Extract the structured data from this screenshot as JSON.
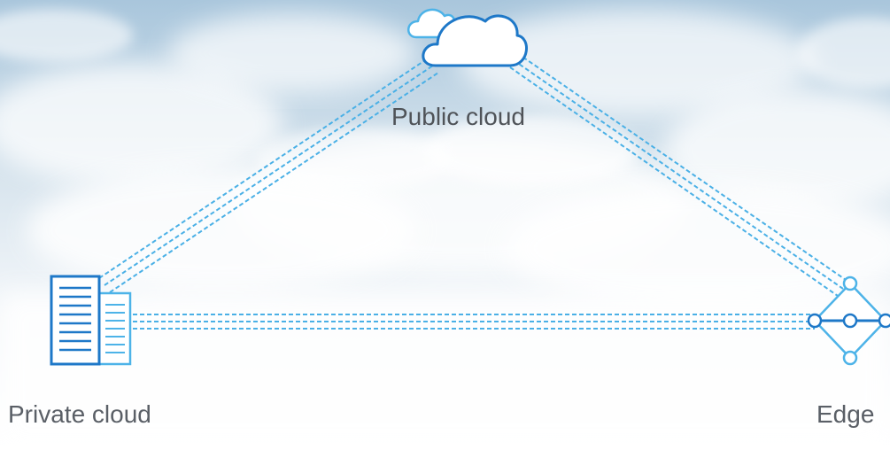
{
  "labels": {
    "public_cloud": "Public cloud",
    "private_cloud": "Private cloud",
    "edge": "Edge"
  },
  "colors": {
    "icon_dark_blue": "#1e78c8",
    "icon_light_blue": "#4db3e8",
    "connection_line": "#4ab0e6",
    "label_text": "#5a5f66",
    "sky_top": "#a9c6dc",
    "sky_bottom": "#ffffff"
  },
  "icons": {
    "public_cloud": "cloud-icon",
    "private_cloud": "server-building-icon",
    "edge": "edge-network-node-icon"
  },
  "connections": [
    {
      "from": "private_cloud",
      "to": "public_cloud",
      "style": "triple-dashed"
    },
    {
      "from": "public_cloud",
      "to": "edge",
      "style": "triple-dashed"
    },
    {
      "from": "private_cloud",
      "to": "edge",
      "style": "triple-dashed"
    }
  ]
}
